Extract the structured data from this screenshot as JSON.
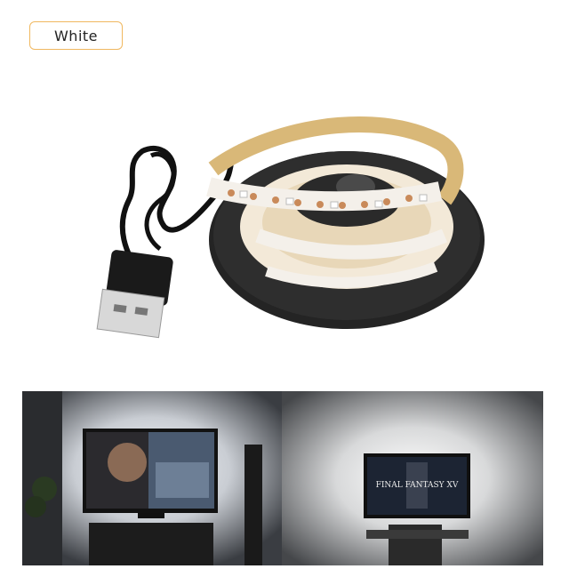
{
  "variant_label": "White",
  "colors": {
    "label_border": "#f0b860",
    "strip_backing": "#d9b878",
    "reel": "#2b2b2b",
    "led_pad": "#c98a5a",
    "room_dark": "#1f2226"
  },
  "photo_left": {
    "screen_text": ""
  },
  "photo_right": {
    "screen_text": "FINAL FANTASY XV"
  }
}
